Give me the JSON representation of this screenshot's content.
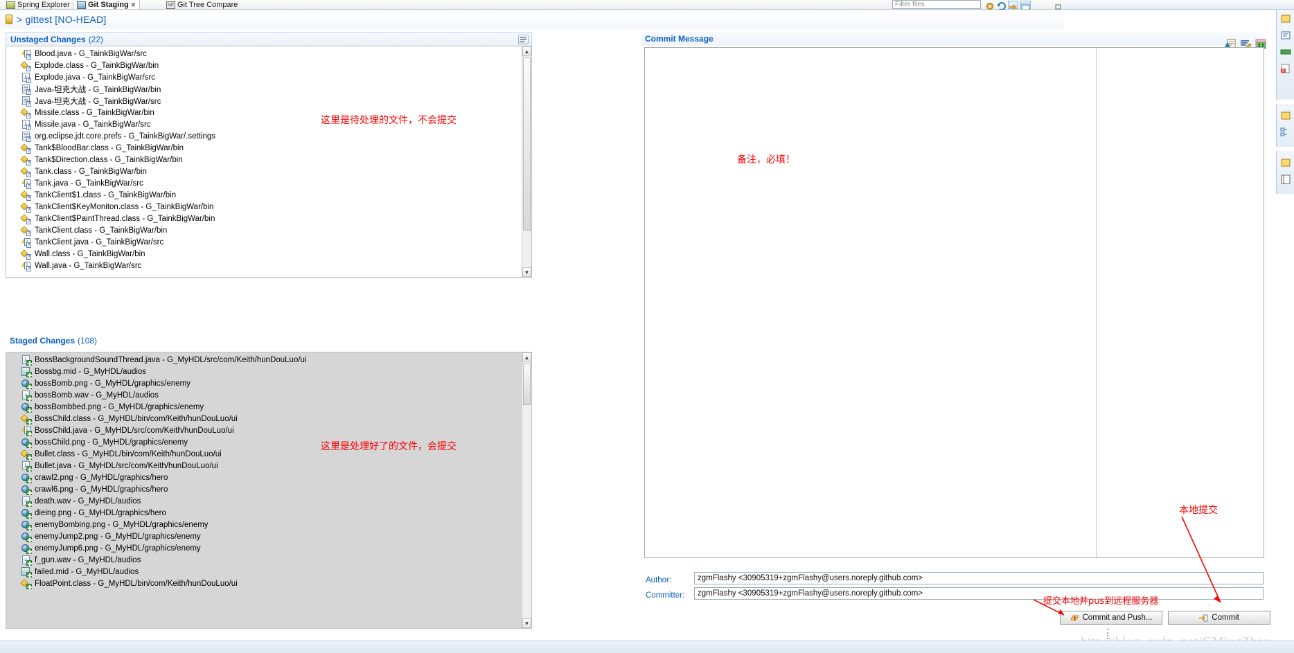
{
  "window": {
    "tabs": [
      {
        "label": "Spring Explorer",
        "icon": "spring-icon",
        "active": false
      },
      {
        "label": "Git Staging",
        "icon": "git-staging-icon",
        "active": true
      },
      {
        "label": "Git Tree Compare",
        "icon": "git-tree-compare-icon",
        "active": false
      }
    ],
    "filter_placeholder": "Filter files",
    "watermark": "http://blog. csdn. net/GMingZhou"
  },
  "repository": {
    "icon": "repository-icon",
    "label": "> gittest [NO-HEAD]"
  },
  "unstaged": {
    "title": "Unstaged Changes",
    "count": "(22)",
    "menu_icon": "view-menu-icon",
    "files": [
      {
        "name": "Blood.java - G_TainkBigWar/src",
        "icon": "java-warning-icon"
      },
      {
        "name": "Explode.class - G_TainkBigWar/bin",
        "icon": "class-icon"
      },
      {
        "name": "Explode.java - G_TainkBigWar/src",
        "icon": "java-icon"
      },
      {
        "name": "Java-坦克大战 - G_TainkBigWar/bin",
        "icon": "folder-file-icon"
      },
      {
        "name": "Java-坦克大战 - G_TainkBigWar/src",
        "icon": "folder-file-icon"
      },
      {
        "name": "Missile.class - G_TainkBigWar/bin",
        "icon": "class-icon"
      },
      {
        "name": "Missile.java - G_TainkBigWar/src",
        "icon": "java-icon"
      },
      {
        "name": "org.eclipse.jdt.core.prefs - G_TainkBigWar/.settings",
        "icon": "file-icon"
      },
      {
        "name": "Tank$BloodBar.class - G_TainkBigWar/bin",
        "icon": "class-icon"
      },
      {
        "name": "Tank$Direction.class - G_TainkBigWar/bin",
        "icon": "class-icon"
      },
      {
        "name": "Tank.class - G_TainkBigWar/bin",
        "icon": "class-icon"
      },
      {
        "name": "Tank.java - G_TainkBigWar/src",
        "icon": "java-warning-icon"
      },
      {
        "name": "TankClient$1.class - G_TainkBigWar/bin",
        "icon": "class-icon"
      },
      {
        "name": "TankClient$KeyMoniton.class - G_TainkBigWar/bin",
        "icon": "class-icon"
      },
      {
        "name": "TankClient$PaintThread.class - G_TainkBigWar/bin",
        "icon": "class-icon"
      },
      {
        "name": "TankClient.class - G_TainkBigWar/bin",
        "icon": "class-icon"
      },
      {
        "name": "TankClient.java - G_TainkBigWar/src",
        "icon": "java-warning-icon"
      },
      {
        "name": "Wall.class - G_TainkBigWar/bin",
        "icon": "class-icon"
      },
      {
        "name": "Wall.java - G_TainkBigWar/src",
        "icon": "java-warning-icon"
      }
    ],
    "annotation": "这里是待处理的文件，不会提交"
  },
  "staged": {
    "title": "Staged Changes",
    "count": "(108)",
    "files": [
      {
        "name": "BossBackgroundSoundThread.java - G_MyHDL/src/com/Keith/hunDouLuo/ui",
        "icon": "java-added-icon"
      },
      {
        "name": "Bossbg.mid - G_MyHDL/audios",
        "icon": "midi-added-icon"
      },
      {
        "name": "bossBomb.png - G_MyHDL/graphics/enemy",
        "icon": "image-added-icon"
      },
      {
        "name": "bossBomb.wav - G_MyHDL/audios",
        "icon": "audio-added-icon"
      },
      {
        "name": "bossBombbed.png - G_MyHDL/graphics/enemy",
        "icon": "image-added-icon"
      },
      {
        "name": "BossChild.class - G_MyHDL/bin/com/Keith/hunDouLuo/ui",
        "icon": "class-added-icon"
      },
      {
        "name": "BossChild.java - G_MyHDL/src/com/Keith/hunDouLuo/ui",
        "icon": "java-warning-added-icon"
      },
      {
        "name": "bossChild.png - G_MyHDL/graphics/enemy",
        "icon": "image-added-icon"
      },
      {
        "name": "Bullet.class - G_MyHDL/bin/com/Keith/hunDouLuo/ui",
        "icon": "class-added-icon"
      },
      {
        "name": "Bullet.java - G_MyHDL/src/com/Keith/hunDouLuo/ui",
        "icon": "java-added-icon"
      },
      {
        "name": "crawl2.png - G_MyHDL/graphics/hero",
        "icon": "image-added-icon"
      },
      {
        "name": "crawl6.png - G_MyHDL/graphics/hero",
        "icon": "image-added-icon"
      },
      {
        "name": "death.wav - G_MyHDL/audios",
        "icon": "audio-added-icon"
      },
      {
        "name": "dieing.png - G_MyHDL/graphics/hero",
        "icon": "image-added-icon"
      },
      {
        "name": "enemyBombing.png - G_MyHDL/graphics/enemy",
        "icon": "image-added-icon"
      },
      {
        "name": "enemyJump2.png - G_MyHDL/graphics/enemy",
        "icon": "image-added-icon"
      },
      {
        "name": "enemyJump6.png - G_MyHDL/graphics/enemy",
        "icon": "image-added-icon"
      },
      {
        "name": "f_gun.wav - G_MyHDL/audios",
        "icon": "audio-added-icon"
      },
      {
        "name": "failed.mid - G_MyHDL/audios",
        "icon": "midi-added-icon"
      },
      {
        "name": "FloatPoint.class - G_MyHDL/bin/com/Keith/hunDouLuo/ui",
        "icon": "class-added-icon"
      }
    ],
    "annotation": "这里是处理好了的文件，会提交"
  },
  "commit_message": {
    "title": "Commit Message",
    "value": "",
    "annotation": "备注，必填！",
    "toolbar_icons": [
      "add-signed-off-icon",
      "amend-commit-icon",
      "add-change-id-icon"
    ]
  },
  "commit_form": {
    "author_label": "Author:",
    "author_value": "zgmFlashy <30905319+zgmFlashy@users.noreply.github.com>",
    "committer_label": "Committer:",
    "committer_value": "zgmFlashy <30905319+zgmFlashy@users.noreply.github.com>",
    "commit_and_push_label": "Commit and Push...",
    "commit_label": "Commit",
    "annotation_push": "提交本地并pus到远程服务器",
    "annotation_local": "本地提交"
  }
}
